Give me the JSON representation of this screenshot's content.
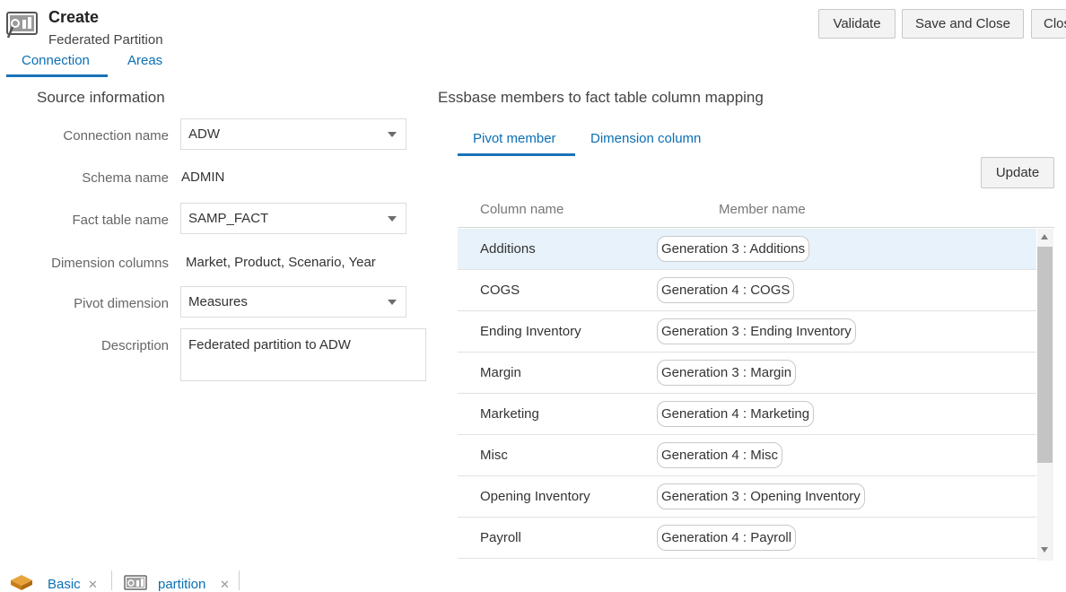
{
  "header": {
    "title": "Create",
    "subtitle": "Federated Partition",
    "tabs": [
      "Connection",
      "Areas"
    ]
  },
  "toolbar": {
    "validate_label": "Validate",
    "save_close_label": "Save and Close",
    "close_label": "Close"
  },
  "source": {
    "title": "Source information",
    "connection_name_label": "Connection name",
    "connection_name_value": "ADW",
    "schema_name_label": "Schema name",
    "schema_name_value": "ADMIN",
    "fact_table_label": "Fact table name",
    "fact_table_value": "SAMP_FACT",
    "dimension_columns_label": "Dimension columns",
    "dimension_columns_value": "Market, Product, Scenario, Year",
    "pivot_dimension_label": "Pivot dimension",
    "pivot_dimension_value": "Measures",
    "description_label": "Description",
    "description_value": "Federated partition to ADW"
  },
  "mapping": {
    "title": "Essbase members to fact table column mapping",
    "tabs": [
      "Pivot member",
      "Dimension column"
    ],
    "update_label": "Update",
    "columns": [
      "Column name",
      "Member name"
    ],
    "rows": [
      {
        "column": "Additions",
        "member": "Generation 3 : Additions"
      },
      {
        "column": "COGS",
        "member": "Generation 4 : COGS"
      },
      {
        "column": "Ending Inventory",
        "member": "Generation 3 : Ending Inventory"
      },
      {
        "column": "Margin",
        "member": "Generation 3 : Margin"
      },
      {
        "column": "Marketing",
        "member": "Generation 4 : Marketing"
      },
      {
        "column": "Misc",
        "member": "Generation 4 : Misc"
      },
      {
        "column": "Opening Inventory",
        "member": "Generation 3 : Opening Inventory"
      },
      {
        "column": "Payroll",
        "member": "Generation 4 : Payroll"
      }
    ]
  },
  "bottom_tabs": [
    {
      "label": "Basic",
      "icon": "cube-icon"
    },
    {
      "label": "partition",
      "icon": "partition-icon"
    }
  ],
  "colors": {
    "accent": "#1a73b8",
    "link": "#0a6fb4",
    "selected_row": "#e8f2fa"
  }
}
